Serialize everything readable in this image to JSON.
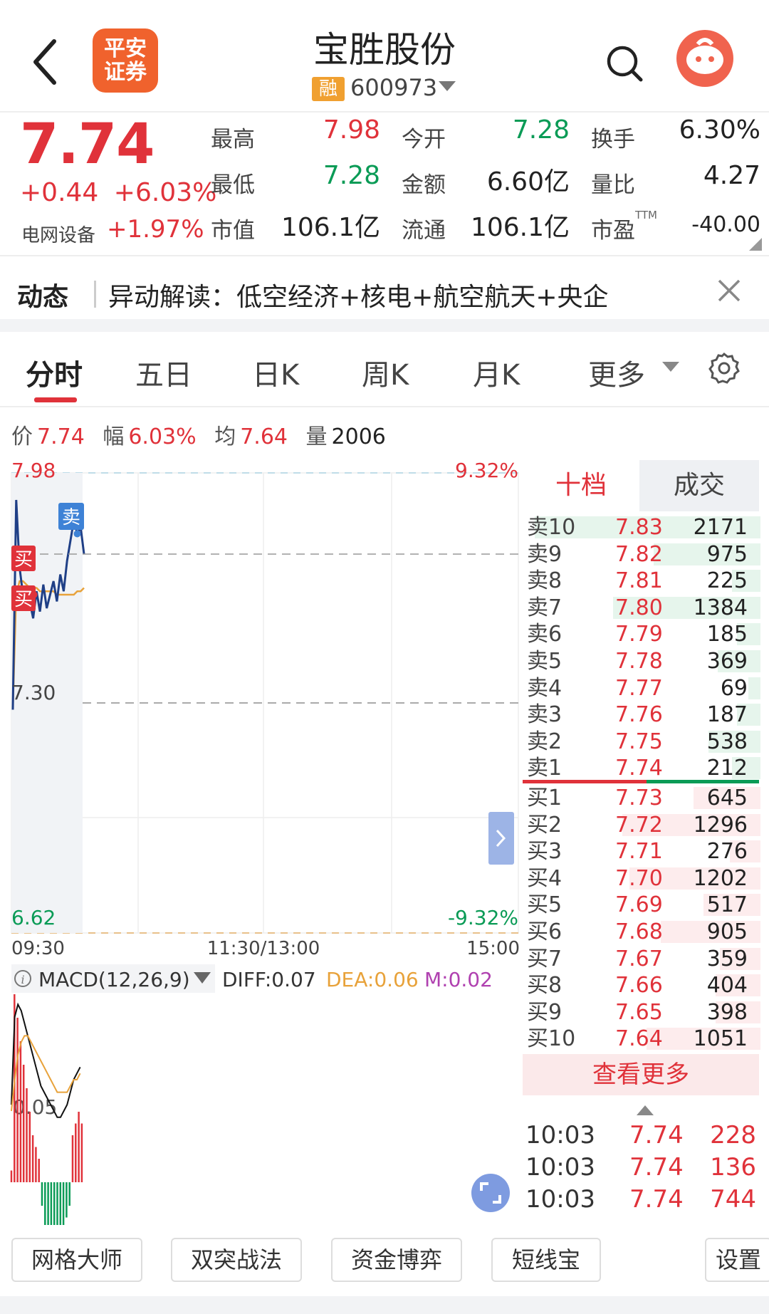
{
  "header": {
    "logo_line1": "平安",
    "logo_line2": "证券",
    "stock_name": "宝胜股份",
    "margin_badge": "融",
    "stock_code": "600973"
  },
  "quote": {
    "price": "7.74",
    "change": "+0.44",
    "change_pct": "+6.03%",
    "sector_name": "电网设备",
    "sector_pct": "+1.97%",
    "fields": [
      {
        "label": "最高",
        "value": "7.98",
        "color": "red"
      },
      {
        "label": "今开",
        "value": "7.28",
        "color": "green"
      },
      {
        "label": "换手",
        "value": "6.30%",
        "color": "dark"
      },
      {
        "label": "最低",
        "value": "7.28",
        "color": "green"
      },
      {
        "label": "金额",
        "value": "6.60亿",
        "color": "dark"
      },
      {
        "label": "量比",
        "value": "4.27",
        "color": "dark"
      },
      {
        "label": "市值",
        "value": "106.1亿",
        "color": "dark"
      },
      {
        "label": "流通",
        "value": "106.1亿",
        "color": "dark"
      },
      {
        "label": "市盈",
        "value": "-40.00",
        "color": "dark"
      }
    ],
    "pe_superscript": "TTM"
  },
  "news": {
    "label": "动态",
    "text": "异动解读：低空经济+核电+航空航天+央企"
  },
  "tabs": [
    "分时",
    "五日",
    "日K",
    "周K",
    "月K",
    "更多"
  ],
  "active_tab": "分时",
  "info_line": {
    "price_label": "价",
    "price": "7.74",
    "amp_label": "幅",
    "amp": "6.03%",
    "avg_label": "均",
    "avg": "7.64",
    "vol_label": "量",
    "vol": "2006"
  },
  "chart_data": {
    "type": "line",
    "title": "",
    "y_high_label": "7.98",
    "y_mid_label": "7.30",
    "y_low_label": "6.62",
    "pct_high_label": "9.32%",
    "pct_low_label": "-9.32%",
    "ylim": [
      6.62,
      7.98
    ],
    "prev_close": 7.3,
    "x_labels": [
      "09:30",
      "11:30/13:00",
      "15:00"
    ],
    "price_series": [
      7.28,
      7.9,
      7.7,
      7.62,
      7.58,
      7.6,
      7.55,
      7.63,
      7.57,
      7.65,
      7.58,
      7.62,
      7.66,
      7.6,
      7.68,
      7.63,
      7.72,
      7.78,
      7.84,
      7.8,
      7.82,
      7.74
    ],
    "avg_series": [
      7.28,
      7.62,
      7.66,
      7.66,
      7.65,
      7.64,
      7.64,
      7.64,
      7.63,
      7.63,
      7.63,
      7.63,
      7.63,
      7.62,
      7.62,
      7.62,
      7.62,
      7.62,
      7.62,
      7.63,
      7.63,
      7.64
    ],
    "markers": [
      {
        "label": "买",
        "index": 4,
        "kind": "buy"
      },
      {
        "label": "买",
        "index": 4,
        "kind": "buy"
      },
      {
        "label": "卖",
        "index": 19,
        "kind": "sell"
      }
    ],
    "macd": {
      "label": "MACD(12,26,9)",
      "diff_label": "DIFF:0.07",
      "dea_label": "DEA:0.06",
      "m_label": "M:0.02",
      "zero_label": "0.05",
      "hist": [
        0.01,
        0.16,
        0.14,
        0.12,
        0.1,
        0.08,
        0.06,
        0.04,
        0.03,
        0.02,
        -0.02,
        -0.04,
        -0.05,
        -0.06,
        -0.06,
        -0.05,
        -0.05,
        -0.04,
        -0.03,
        -0.02,
        0.04,
        0.05,
        0.06,
        0.05
      ],
      "diff": [
        0.01,
        0.15,
        0.17,
        0.16,
        0.14,
        0.12,
        0.1,
        0.08,
        0.06,
        0.04,
        0.03,
        0.02,
        0.01,
        0.0,
        -0.01,
        -0.01,
        0.0,
        0.01,
        0.03,
        0.05,
        0.06,
        0.07
      ],
      "dea": [
        0.0,
        0.05,
        0.09,
        0.11,
        0.12,
        0.12,
        0.11,
        0.1,
        0.09,
        0.08,
        0.07,
        0.06,
        0.05,
        0.04,
        0.03,
        0.03,
        0.03,
        0.03,
        0.04,
        0.05,
        0.05,
        0.06
      ]
    }
  },
  "order_book": {
    "tabs": [
      "十档",
      "成交"
    ],
    "asks": [
      {
        "label": "卖10",
        "price": "7.83",
        "vol": "2171",
        "bar": 0.95
      },
      {
        "label": "卖9",
        "price": "7.82",
        "vol": "975",
        "bar": 0.45
      },
      {
        "label": "卖8",
        "price": "7.81",
        "vol": "225",
        "bar": 0.12
      },
      {
        "label": "卖7",
        "price": "7.80",
        "vol": "1384",
        "bar": 0.62
      },
      {
        "label": "卖6",
        "price": "7.79",
        "vol": "185",
        "bar": 0.1
      },
      {
        "label": "卖5",
        "price": "7.78",
        "vol": "369",
        "bar": 0.18
      },
      {
        "label": "卖4",
        "price": "7.77",
        "vol": "69",
        "bar": 0.05
      },
      {
        "label": "卖3",
        "price": "7.76",
        "vol": "187",
        "bar": 0.1
      },
      {
        "label": "卖2",
        "price": "7.75",
        "vol": "538",
        "bar": 0.22
      },
      {
        "label": "卖1",
        "price": "7.74",
        "vol": "212",
        "bar": 0.12
      }
    ],
    "bids": [
      {
        "label": "买1",
        "price": "7.73",
        "vol": "645",
        "bar": 0.28
      },
      {
        "label": "买2",
        "price": "7.72",
        "vol": "1296",
        "bar": 0.58
      },
      {
        "label": "买3",
        "price": "7.71",
        "vol": "276",
        "bar": 0.13
      },
      {
        "label": "买4",
        "price": "7.70",
        "vol": "1202",
        "bar": 0.55
      },
      {
        "label": "买5",
        "price": "7.69",
        "vol": "517",
        "bar": 0.24
      },
      {
        "label": "买6",
        "price": "7.68",
        "vol": "905",
        "bar": 0.42
      },
      {
        "label": "买7",
        "price": "7.67",
        "vol": "359",
        "bar": 0.17
      },
      {
        "label": "买8",
        "price": "7.66",
        "vol": "404",
        "bar": 0.19
      },
      {
        "label": "买9",
        "price": "7.65",
        "vol": "398",
        "bar": 0.19
      },
      {
        "label": "买10",
        "price": "7.64",
        "vol": "1051",
        "bar": 0.48
      }
    ],
    "see_more": "查看更多",
    "trades": [
      {
        "time": "10:03",
        "price": "7.74",
        "vol": "228"
      },
      {
        "time": "10:03",
        "price": "7.74",
        "vol": "136"
      },
      {
        "time": "10:03",
        "price": "7.74",
        "vol": "744"
      }
    ]
  },
  "bottom_buttons": [
    "网格大师",
    "双突战法",
    "资金博弈",
    "短线宝",
    "设置"
  ],
  "colors": {
    "red": "#e0323a",
    "green": "#0a9b56",
    "avg": "#e8a23a",
    "price_line": "#1f3f86",
    "macd_m": "#b041b0"
  }
}
